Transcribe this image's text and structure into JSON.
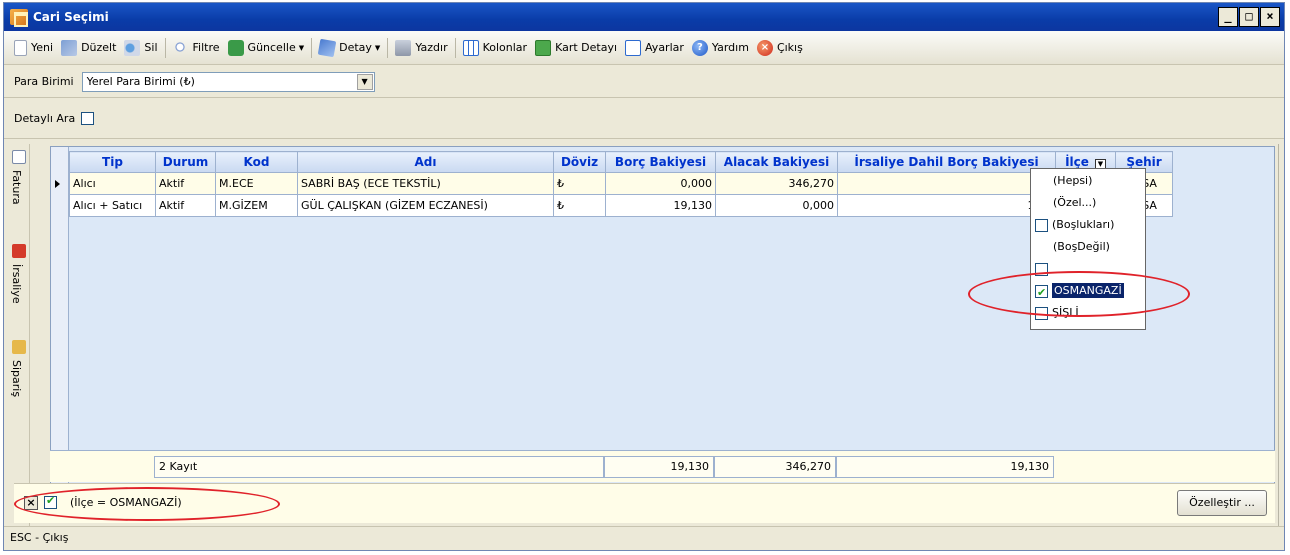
{
  "window": {
    "title": "Cari Seçimi"
  },
  "toolbar": {
    "items": [
      {
        "label": "Yeni",
        "icon": "new-document-icon"
      },
      {
        "label": "Düzelt",
        "icon": "edit-icon"
      },
      {
        "label": "Sil",
        "icon": "delete-icon"
      },
      {
        "label": "Filtre",
        "icon": "filter-icon"
      },
      {
        "label": "Güncelle",
        "icon": "refresh-icon",
        "dropdown": true
      },
      {
        "label": "Detay",
        "icon": "detail-icon",
        "dropdown": true
      },
      {
        "label": "Yazdır",
        "icon": "printer-icon"
      },
      {
        "label": "Kolonlar",
        "icon": "columns-icon"
      },
      {
        "label": "Kart Detayı",
        "icon": "card-detail-icon"
      },
      {
        "label": "Ayarlar",
        "icon": "settings-icon"
      },
      {
        "label": "Yardım",
        "icon": "help-icon"
      },
      {
        "label": "Çıkış",
        "icon": "exit-icon"
      }
    ]
  },
  "currency": {
    "label": "Para Birimi",
    "value": "Yerel Para Birimi (₺)"
  },
  "detailed_search": {
    "label": "Detaylı Ara",
    "checked": false
  },
  "side_panel": {
    "items": [
      "Fatura",
      "İrsaliye",
      "Sipariş"
    ]
  },
  "grid": {
    "columns": [
      "Tip",
      "Durum",
      "Kod",
      "Adı",
      "Döviz",
      "Borç Bakiyesi",
      "Alacak Bakiyesi",
      "İrsaliye Dahil Borç Bakiyesi",
      "İlçe",
      "Şehir"
    ],
    "rows": [
      {
        "tip": "Alıcı",
        "durum": "Aktif",
        "kod": "M.ECE",
        "adi": "SABRİ BAŞ (ECE TEKSTİL)",
        "doviz": "₺",
        "borc": "0,000",
        "alacak": "346,270",
        "irsaliye": "0,0",
        "ilce": "",
        "sehir": "BURSA"
      },
      {
        "tip": "Alıcı + Satıcı",
        "durum": "Aktif",
        "kod": "M.GİZEM",
        "adi": "GÜL ÇALIŞKAN (GİZEM ECZANESİ)",
        "doviz": "₺",
        "borc": "19,130",
        "alacak": "0,000",
        "irsaliye": "19,1",
        "ilce": "",
        "sehir": "BURSA"
      }
    ],
    "footer": {
      "count": "2 Kayıt",
      "borc": "19,130",
      "alacak": "346,270",
      "irsaliye": "19,130"
    }
  },
  "filter_popup": {
    "items": [
      {
        "label": "(Hepsi)",
        "checkbox": false
      },
      {
        "label": "(Özel...)",
        "checkbox": false
      },
      {
        "label": "(Boşlukları)",
        "checkbox": true,
        "checked": false
      },
      {
        "label": "(BoşDeğil)",
        "checkbox": false
      },
      {
        "label": "",
        "checkbox": true,
        "checked": false
      },
      {
        "label": "OSMANGAZİ",
        "checkbox": true,
        "checked": true,
        "selected": true
      },
      {
        "label": "ŞİŞLİ",
        "checkbox": true,
        "checked": false
      }
    ]
  },
  "filter_bar": {
    "expression": "(İlçe = OSMANGAZİ)",
    "customize_label": "Özelleştir ..."
  },
  "status": {
    "text": "ESC - Çıkış"
  },
  "colors": {
    "title_bar": "#0a3ca8",
    "header_text": "#0033cc",
    "highlight": "#e0222a",
    "selection": "#0a246a"
  }
}
